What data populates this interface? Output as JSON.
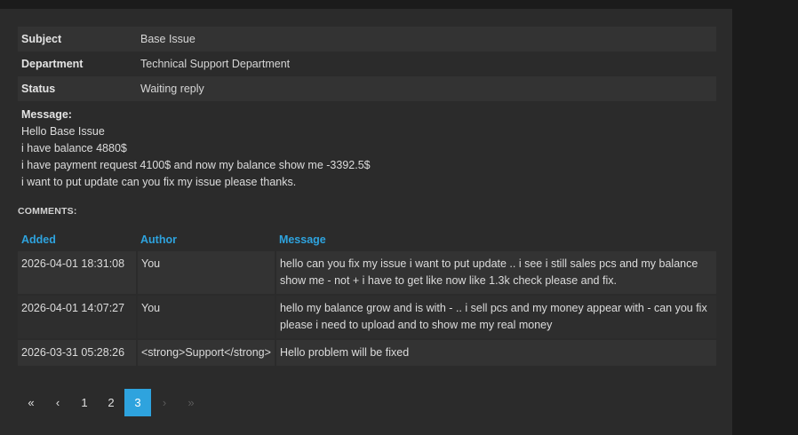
{
  "ticket": {
    "subject_label": "Subject",
    "subject_value": "Base Issue",
    "department_label": "Department",
    "department_value": "Technical Support Department",
    "status_label": "Status",
    "status_value": "Waiting reply",
    "message_label": "Message:",
    "message_lines": [
      "Hello Base Issue",
      "i have balance 4880$",
      "i have payment request 4100$ and now my balance show me -3392.5$",
      "i want to put update can you fix my issue please thanks."
    ]
  },
  "comments": {
    "title": "COMMENTS:",
    "headers": {
      "added": "Added",
      "author": "Author",
      "message": "Message"
    },
    "rows": [
      {
        "added": "2026-04-01 18:31:08",
        "author": "You",
        "message": "hello can you fix my issue i want to put update .. i see i still sales pcs and my balance show me - not + i have to get like now like 1.3k check please and fix."
      },
      {
        "added": "2026-04-01 14:07:27",
        "author": "You",
        "message": "hello my balance grow and is with - .. i sell pcs and my money appear with - can you fix please i need to upload and to show me my real money"
      },
      {
        "added": "2026-03-31 05:28:26",
        "author": "<strong>Support</strong>",
        "message": "Hello problem will be fixed"
      }
    ]
  },
  "pagination": {
    "first": "«",
    "prev": "‹",
    "pages": [
      "1",
      "2",
      "3"
    ],
    "current": "3",
    "next": "›",
    "last": "»"
  },
  "colors": {
    "accent": "#2ea3de",
    "panel": "#2b2b2b",
    "row": "#333333"
  }
}
